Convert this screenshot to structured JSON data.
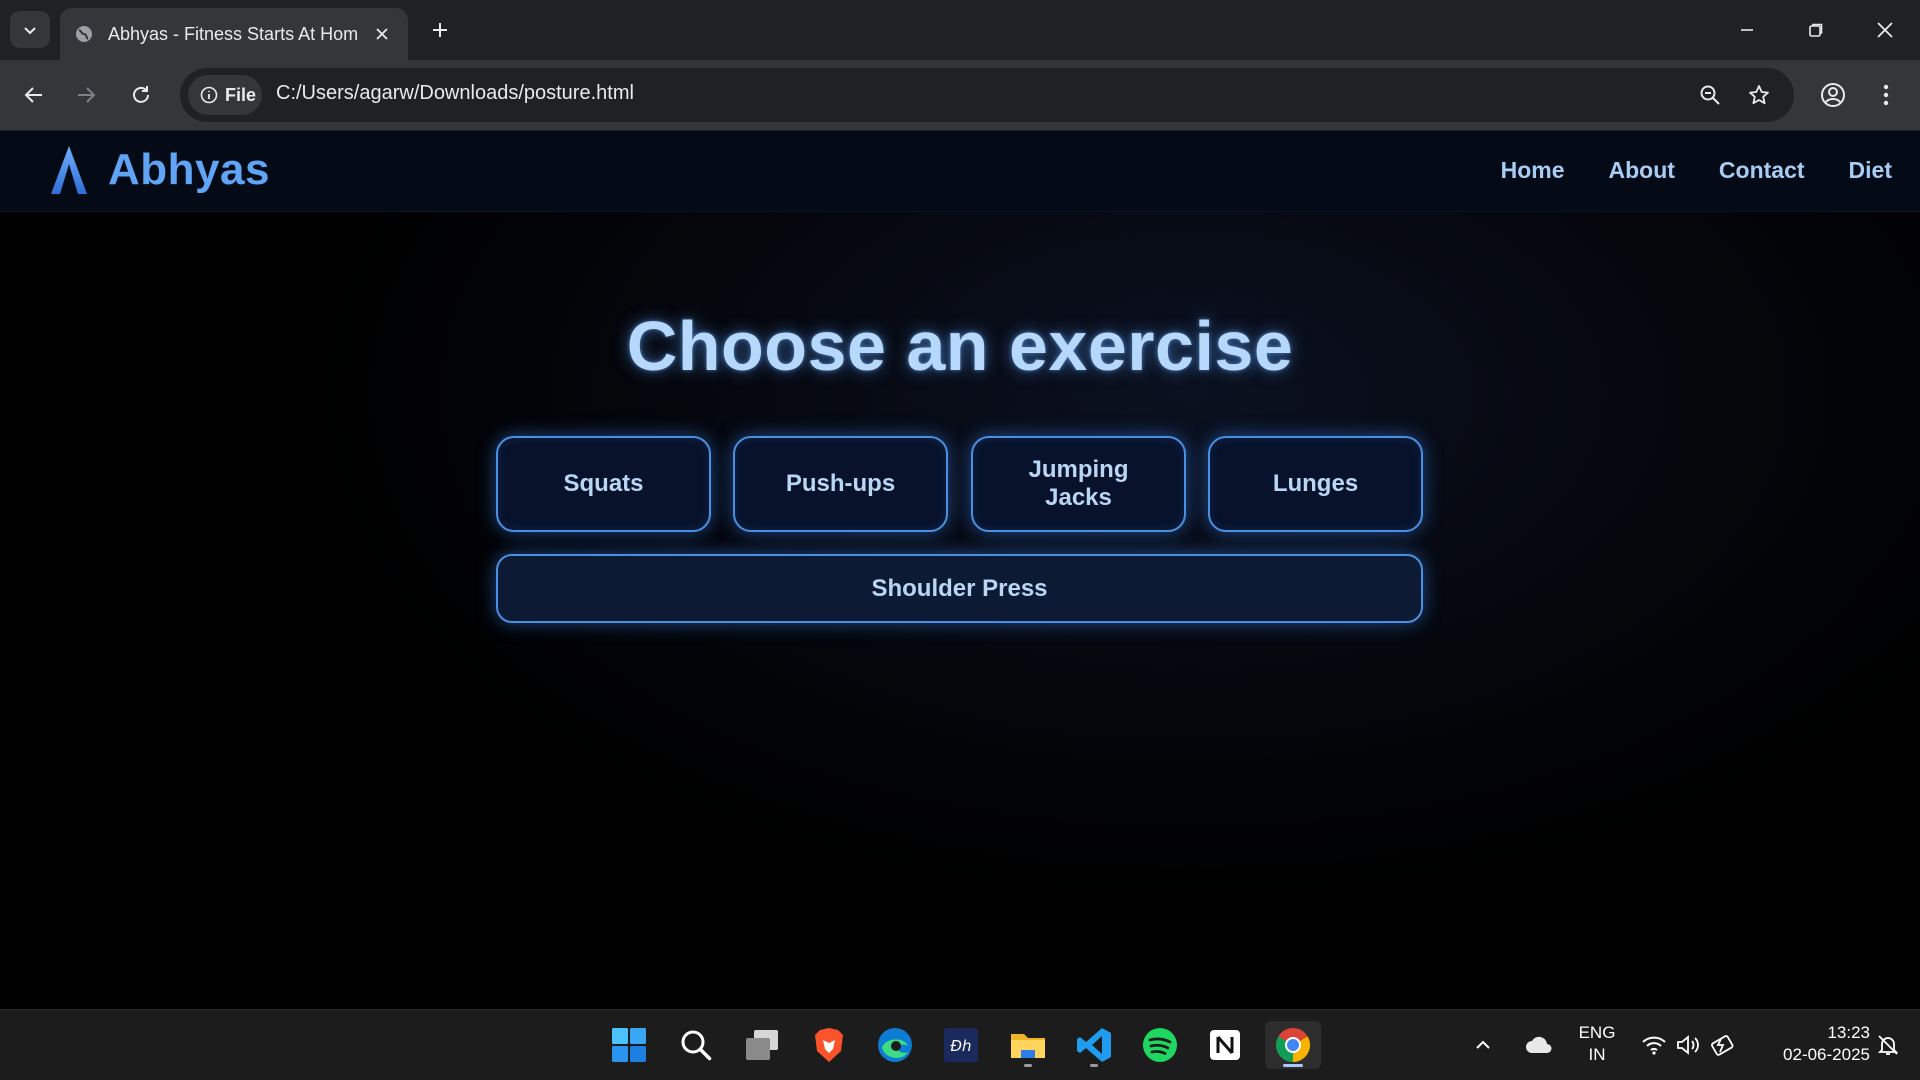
{
  "browser": {
    "tab_title": "Abhyas - Fitness Starts At Home",
    "address_chip": "File",
    "url": "C:/Users/agarw/Downloads/posture.html"
  },
  "site": {
    "brand_name": "Abhyas",
    "brand_color": "#5fa4f5",
    "accent_color": "#4a90e2",
    "nav": [
      "Home",
      "About",
      "Contact",
      "Diet"
    ]
  },
  "main": {
    "heading": "Choose an exercise",
    "exercises": [
      "Squats",
      "Push-ups",
      "Jumping Jacks",
      "Lunges"
    ],
    "wide_exercise": "Shoulder Press"
  },
  "taskbar": {
    "apps": [
      "windows-start",
      "search",
      "task-view",
      "brave",
      "edge",
      "dh-app",
      "file-explorer",
      "vs-code",
      "spotify",
      "notion",
      "chrome"
    ],
    "language_top": "ENG",
    "language_bottom": "IN",
    "time": "13:23",
    "date": "02-06-2025"
  }
}
